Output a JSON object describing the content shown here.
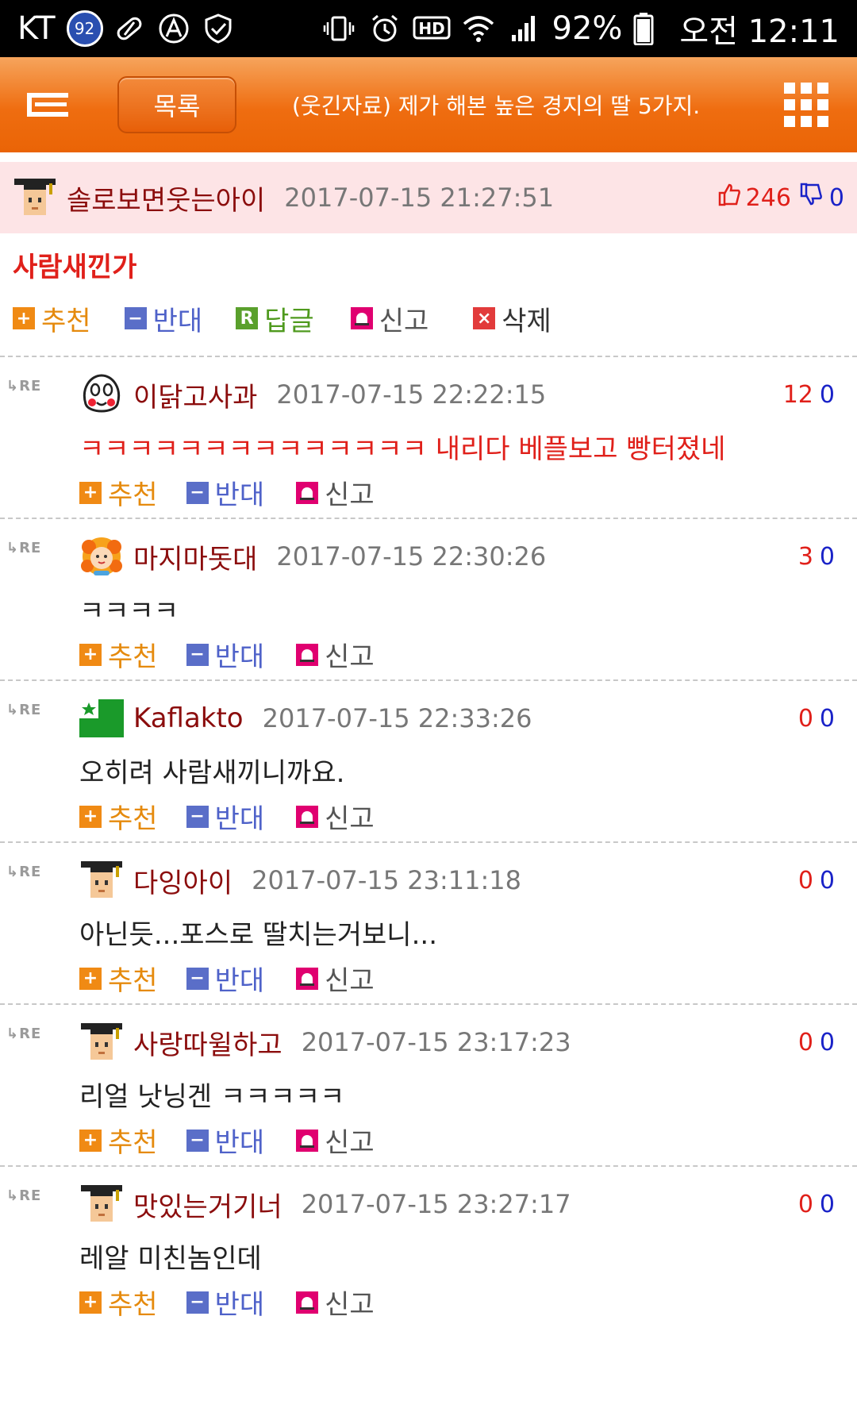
{
  "status_bar": {
    "carrier": "KT",
    "badge": "92",
    "hd": "HD",
    "battery": "92%",
    "time": "오전 12:11"
  },
  "header": {
    "list_button": "목록",
    "title": "(웃긴자료) 제가 해본 높은 경지의 딸 5가지."
  },
  "post": {
    "author": "솔로보면웃는아이",
    "date": "2017-07-15 21:27:51",
    "upvotes": "246",
    "downvotes": "0",
    "text": "사람새낀가",
    "actions": {
      "recommend": "추천",
      "oppose": "반대",
      "reply": "답글",
      "report": "신고",
      "delete": "삭제"
    }
  },
  "comment_labels": {
    "re": "RE",
    "recommend": "추천",
    "oppose": "반대",
    "report": "신고"
  },
  "comments": [
    {
      "author": "이닭고사과",
      "date": "2017-07-15 22:22:15",
      "up": "12",
      "down": "0",
      "text": "ㅋㅋㅋㅋㅋㅋㅋㅋㅋㅋㅋㅋㅋㅋ 내리다 베플보고 빵터졌네",
      "text_color": "red",
      "avatar": "face-icon"
    },
    {
      "author": "마지마돗대",
      "date": "2017-07-15 22:30:26",
      "up": "3",
      "down": "0",
      "text": "ㅋㅋㅋㅋ",
      "text_color": "default",
      "avatar": "flower-face-icon"
    },
    {
      "author": "Kaflakto",
      "date": "2017-07-15 22:33:26",
      "up": "0",
      "down": "0",
      "text": "오히려 사람새끼니까요.",
      "text_color": "default",
      "avatar": "green-flag-icon"
    },
    {
      "author": "다잉아이",
      "date": "2017-07-15 23:11:18",
      "up": "0",
      "down": "0",
      "text": "아닌듯...포스로 딸치는거보니...",
      "text_color": "default",
      "avatar": "graduate-icon"
    },
    {
      "author": "사랑따윌하고",
      "date": "2017-07-15 23:17:23",
      "up": "0",
      "down": "0",
      "text": "리얼 낫닝겐 ㅋㅋㅋㅋㅋ",
      "text_color": "default",
      "avatar": "graduate-icon"
    },
    {
      "author": "맛있는거기너",
      "date": "2017-07-15 23:27:17",
      "up": "0",
      "down": "0",
      "text": "레알 미친놈인데",
      "text_color": "default",
      "avatar": "graduate-icon"
    }
  ]
}
